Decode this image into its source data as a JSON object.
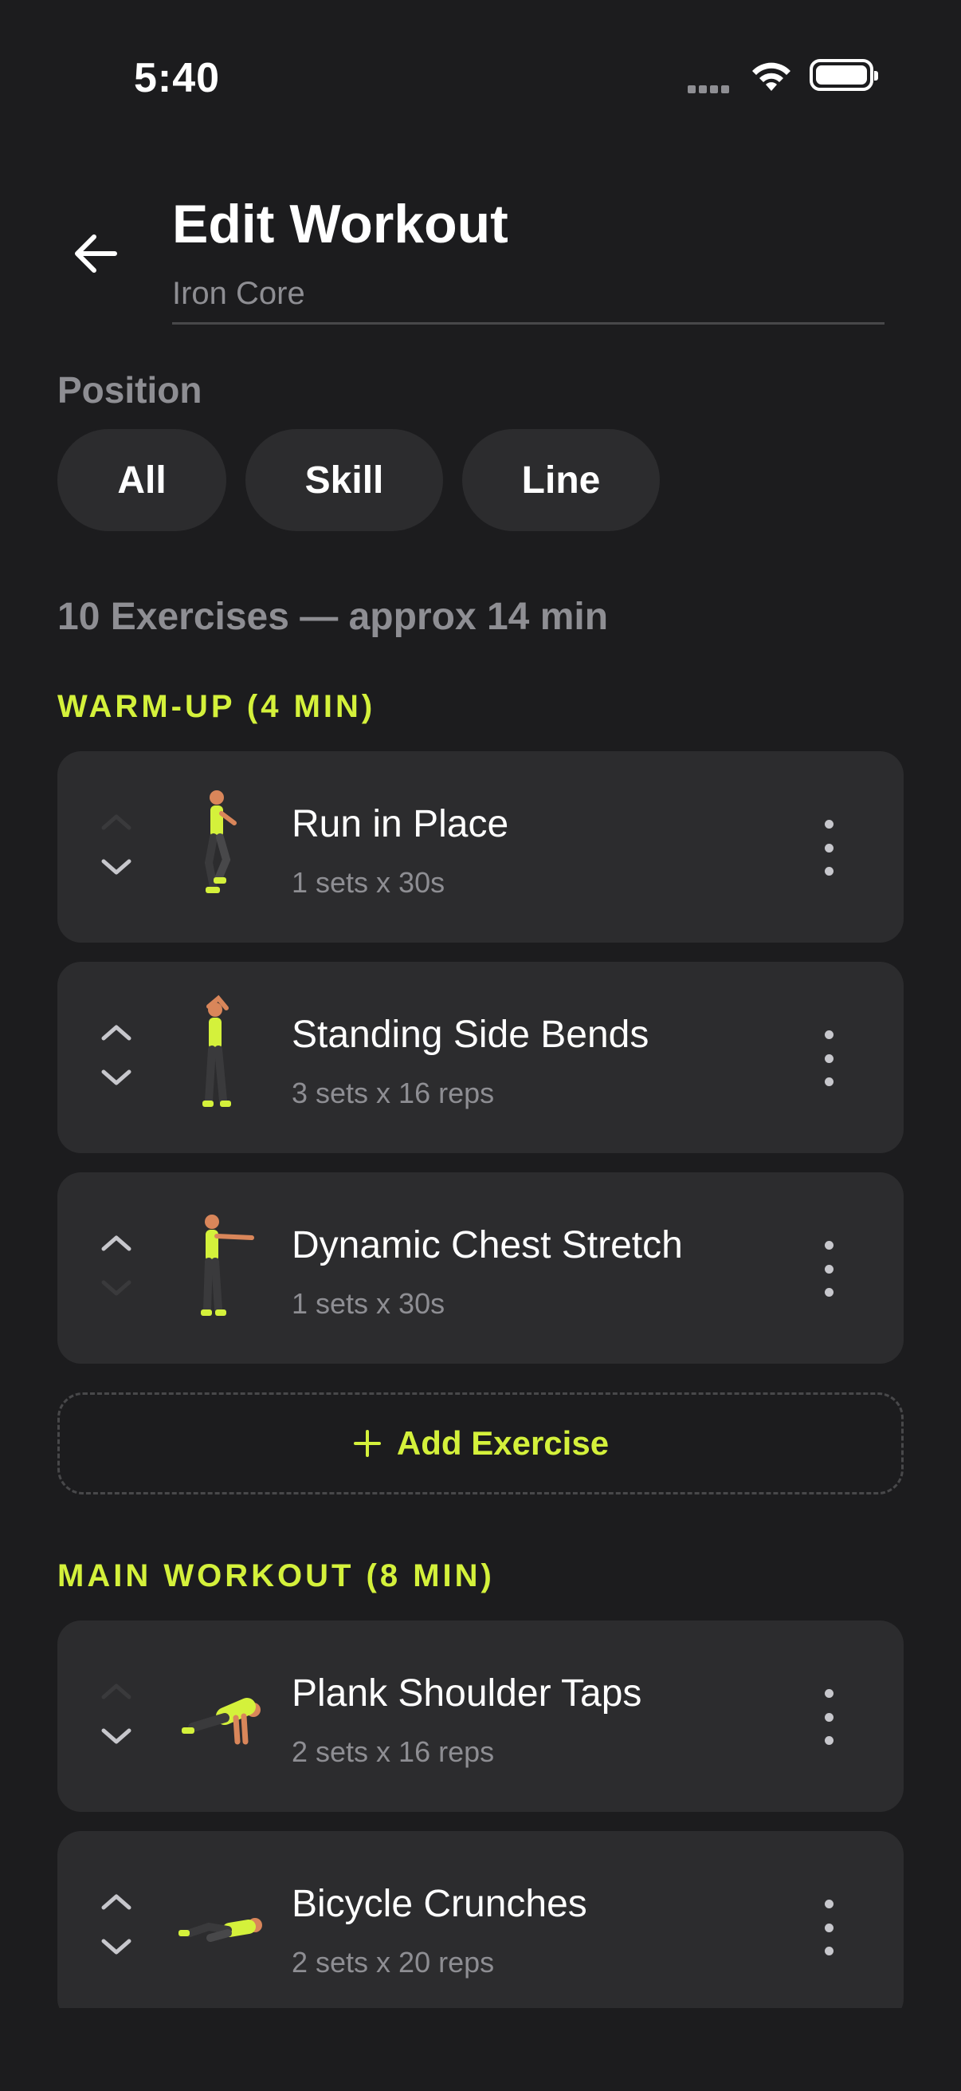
{
  "status_bar": {
    "time": "5:40"
  },
  "header": {
    "title": "Edit Workout",
    "workout_name_value": "Iron Core"
  },
  "position": {
    "label": "Position",
    "chips": [
      "All",
      "Skill",
      "Line"
    ]
  },
  "summary": "10 Exercises — approx 14 min",
  "accent_color": "#d4f13b",
  "groups": [
    {
      "title": "WARM-UP (4 MIN)",
      "exercises": [
        {
          "name": "Run in Place",
          "detail": "1 sets x 30s"
        },
        {
          "name": "Standing Side Bends",
          "detail": "3 sets x 16 reps"
        },
        {
          "name": "Dynamic Chest Stretch",
          "detail": "1 sets x 30s"
        }
      ],
      "add_label": "Add Exercise"
    },
    {
      "title": "MAIN WORKOUT (8 MIN)",
      "exercises": [
        {
          "name": "Plank Shoulder Taps",
          "detail": "2 sets x 16 reps"
        },
        {
          "name": "Bicycle Crunches",
          "detail": "2 sets x 20 reps"
        }
      ]
    }
  ]
}
